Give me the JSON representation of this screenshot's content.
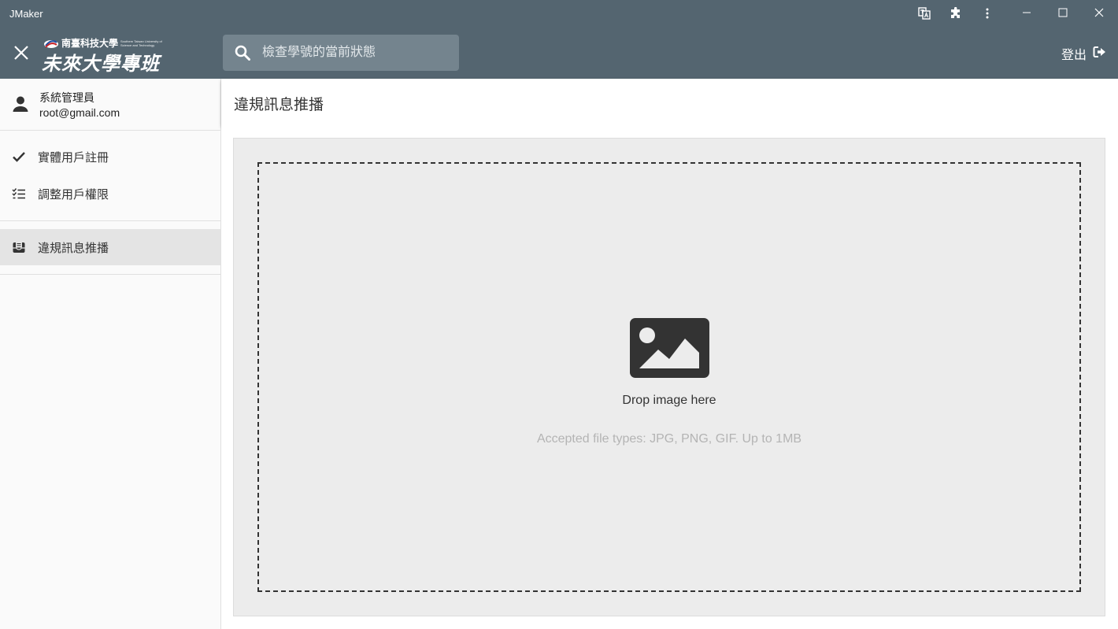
{
  "window": {
    "title": "JMaker",
    "icons": [
      "translate-icon",
      "extensions-icon",
      "more-vert-icon"
    ],
    "controls": [
      "minimize-icon",
      "maximize-icon",
      "close-icon"
    ]
  },
  "header": {
    "logo": {
      "small_text": "南臺科技大學",
      "english_text": "Southern Taiwan University of Science and Technology",
      "main_text": "未來大學專班"
    },
    "search": {
      "placeholder": "檢查學號的當前狀態",
      "value": ""
    },
    "logout_label": "登出"
  },
  "sidebar": {
    "user": {
      "name": "系統管理員",
      "email": "root@gmail.com"
    },
    "groups": [
      {
        "items": [
          {
            "label": "實體用戶註冊",
            "icon": "check-icon",
            "active": false
          },
          {
            "label": "調整用戶權限",
            "icon": "checklist-icon",
            "active": false
          }
        ]
      },
      {
        "items": [
          {
            "label": "違規訊息推播",
            "icon": "inbox-icon",
            "active": true
          }
        ]
      }
    ]
  },
  "main": {
    "title": "違規訊息推播",
    "dropzone": {
      "icon": "image-icon",
      "title": "Drop image here",
      "hint": "Accepted file types: JPG, PNG, GIF. Up to 1MB"
    }
  },
  "colors": {
    "header_bg": "#546570",
    "search_bg": "#74848e",
    "sidebar_bg": "#fafafa",
    "active_item_bg": "#e4e4e4",
    "drop_panel_bg": "#ececec"
  }
}
